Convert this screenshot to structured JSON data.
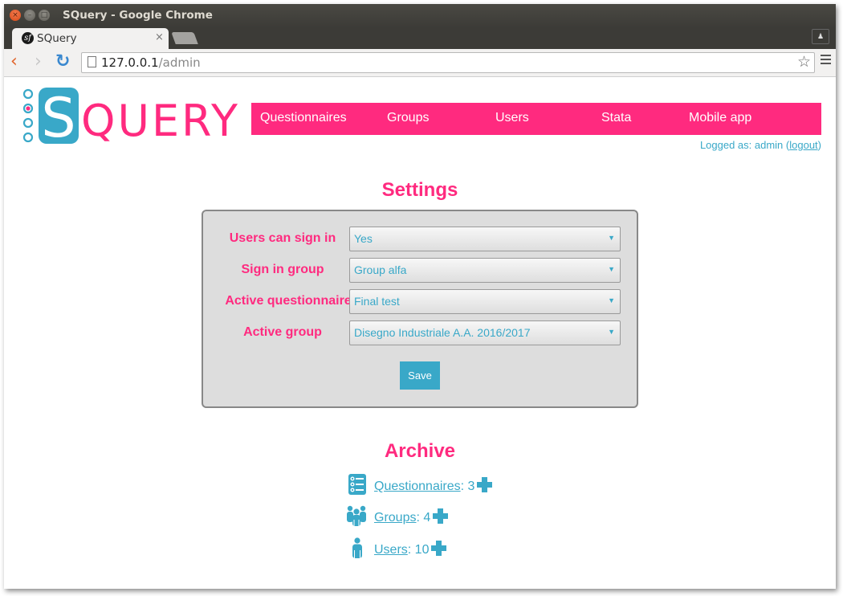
{
  "window": {
    "title": "SQuery - Google Chrome",
    "controls": {
      "close": "×",
      "minimize": "–",
      "maximize": "□"
    }
  },
  "browser": {
    "tab": {
      "title": "SQuery",
      "close": "×",
      "favicon": "symfony-icon"
    },
    "url_host": "127.0.0.1",
    "url_path": "/admin",
    "back": "‹",
    "forward": "›",
    "reload": "↻",
    "star": "☆"
  },
  "header": {
    "logo_letter": "S",
    "logo_text": "QUERY",
    "nav": [
      {
        "label": "Questionnaires"
      },
      {
        "label": "Groups"
      },
      {
        "label": "Users"
      },
      {
        "label": "Stata"
      },
      {
        "label": "Mobile app"
      }
    ],
    "logged_prefix": "Logged as: admin (",
    "logout_label": "logout",
    "logged_suffix": ")"
  },
  "settings": {
    "title": "Settings",
    "fields": [
      {
        "label": "Users can sign in",
        "value": "Yes"
      },
      {
        "label": "Sign in group",
        "value": "Group alfa"
      },
      {
        "label": "Active questionnaire",
        "value": "Final test"
      },
      {
        "label": "Active group",
        "value": "Disegno Industriale A.A. 2016/2017"
      }
    ],
    "save_label": "Save",
    "dropdown_arrow": "▼"
  },
  "archive": {
    "title": "Archive",
    "items": [
      {
        "label": "Questionnaires",
        "count": ": 3",
        "icon": "questionnaire-list-icon"
      },
      {
        "label": "Groups",
        "count": ": 4",
        "icon": "group-icon"
      },
      {
        "label": "Users",
        "count": ": 10",
        "icon": "user-icon"
      }
    ]
  },
  "colors": {
    "brand_pink": "#ff2a7f",
    "brand_blue": "#39a8c8",
    "panel_gray": "#dddddd"
  }
}
